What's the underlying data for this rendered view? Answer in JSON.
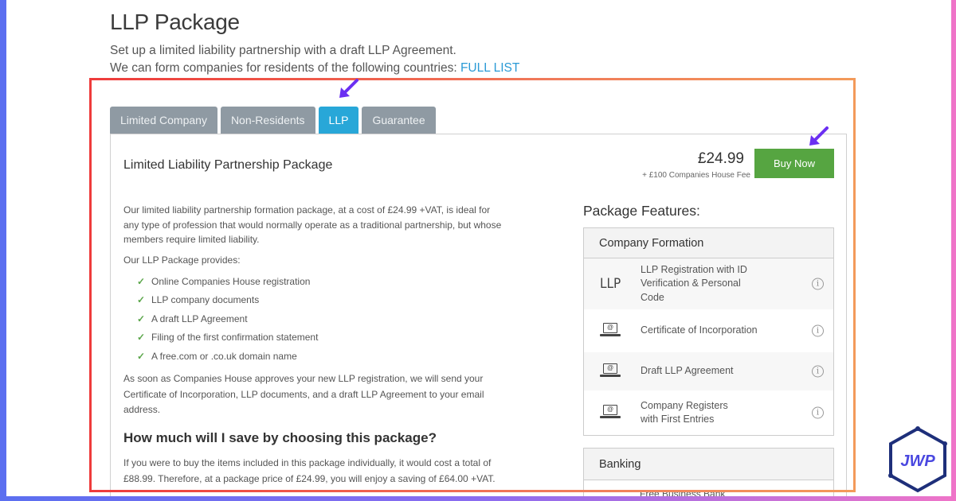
{
  "header": {
    "title": "LLP Package",
    "subtitle": "Set up a limited liability partnership with a draft LLP Agreement.",
    "countries_text": "We can form companies for residents of the following countries:",
    "full_list_link": "FULL LIST"
  },
  "tabs": [
    {
      "label": "Limited Company",
      "active": false
    },
    {
      "label": "Non-Residents",
      "active": false
    },
    {
      "label": "LLP",
      "active": true
    },
    {
      "label": "Guarantee",
      "active": false
    }
  ],
  "package": {
    "title": "Limited Liability Partnership Package",
    "price": "£24.99",
    "fee_note": "+ £100 Companies House Fee",
    "buy_label": "Buy Now",
    "description": "Our limited liability partnership formation package, at a cost of £24.99 +VAT, is ideal for any type of profession that would normally operate as a traditional partnership, but whose members require limited liability.",
    "provides_label": "Our LLP Package provides:",
    "provides_items": [
      "Online Companies House registration",
      "LLP company documents",
      "A draft LLP Agreement",
      "Filing of the first confirmation statement",
      "A free.com or .co.uk domain name"
    ],
    "approval_text": "As soon as Companies House approves your new LLP registration, we will send your Certificate of Incorporation, LLP documents, and a draft LLP Agreement to your email address.",
    "save_heading": "How much will I save by choosing this package?",
    "save_text": "If you were to buy the items included in this package individually, it would cost a total of £88.99. Therefore, at a package price of £24.99, you will enjoy a saving of £64.00 +VAT."
  },
  "features": {
    "heading": "Package Features:",
    "formation_title": "Company Formation",
    "llp_icon_text": "LLP",
    "laptop_icon_text": "@",
    "items": [
      {
        "icon": "llp-text-icon",
        "label": "LLP Registration with ID Verification & Personal Code"
      },
      {
        "icon": "laptop-icon",
        "label": "Certificate of Incorporation"
      },
      {
        "icon": "laptop-icon",
        "label": "Draft LLP Agreement"
      },
      {
        "icon": "laptop-icon",
        "label": "Company Registers with First Entries"
      }
    ],
    "info_glyph": "i",
    "banking_title": "Banking",
    "banking_first_item": "Free Business Bank"
  },
  "brand": {
    "logo_text": "JWP",
    "accent_arrow_color": "#6b2ff2",
    "highlight_color": "#ee3b3b",
    "buy_color": "#56a541",
    "tab_active_color": "#28a7d8"
  }
}
